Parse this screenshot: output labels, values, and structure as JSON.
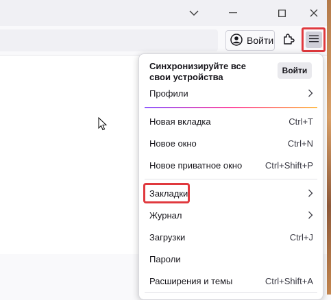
{
  "window": {
    "controls": [
      "chevron-down",
      "minimize",
      "maximize",
      "close"
    ]
  },
  "toolbar": {
    "signin_label": "Войти"
  },
  "panel": {
    "sync_text": "Синхронизируйте все свои устройства",
    "signin_button": "Войти",
    "items": [
      {
        "label": "Профили",
        "shortcut": "",
        "submenu": true
      },
      {
        "label": "Новая вкладка",
        "shortcut": "Ctrl+T",
        "submenu": false
      },
      {
        "label": "Новое окно",
        "shortcut": "Ctrl+N",
        "submenu": false
      },
      {
        "label": "Новое приватное окно",
        "shortcut": "Ctrl+Shift+P",
        "submenu": false
      },
      {
        "label": "Закладки",
        "shortcut": "",
        "submenu": true
      },
      {
        "label": "Журнал",
        "shortcut": "",
        "submenu": true
      },
      {
        "label": "Загрузки",
        "shortcut": "Ctrl+J",
        "submenu": false
      },
      {
        "label": "Пароли",
        "shortcut": "",
        "submenu": false
      },
      {
        "label": "Расширения и темы",
        "shortcut": "Ctrl+Shift+A",
        "submenu": false
      }
    ]
  },
  "colors": {
    "highlight": "#e0393e",
    "accent_gradient": [
      "#9059ff",
      "#ff4aa2",
      "#ffbd4f"
    ]
  }
}
